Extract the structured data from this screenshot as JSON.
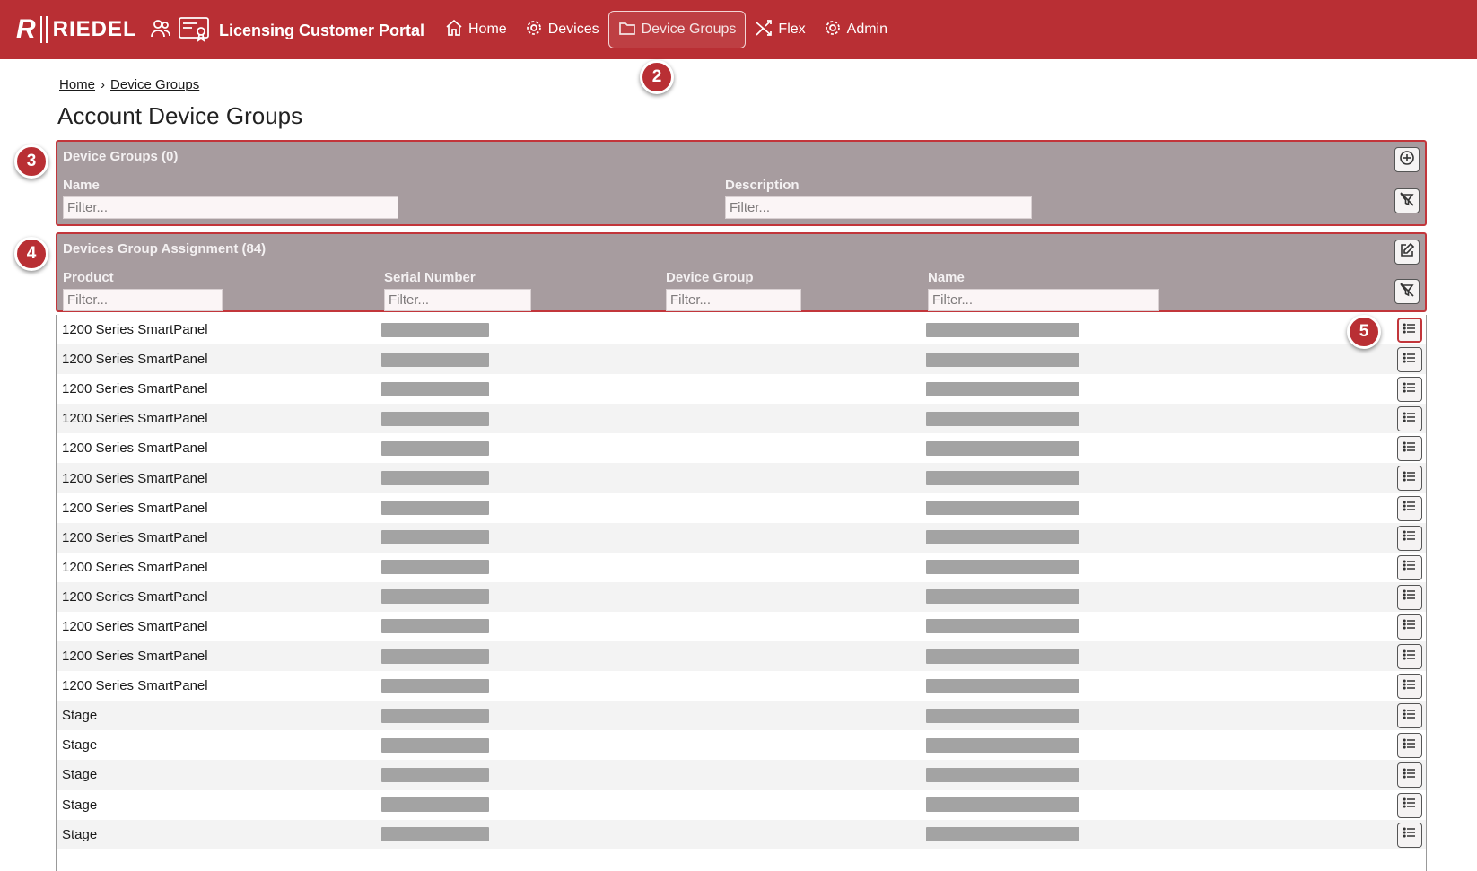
{
  "header": {
    "logo_text": "RIEDEL",
    "logo_mark": "R",
    "portal_title": "Licensing Customer Portal",
    "nav": [
      {
        "label": "Home",
        "icon": "home-icon",
        "active": false
      },
      {
        "label": "Devices",
        "icon": "gear-icon",
        "active": false
      },
      {
        "label": "Device Groups",
        "icon": "folder-icon",
        "active": true
      },
      {
        "label": "Flex",
        "icon": "shuffle-icon",
        "active": false
      },
      {
        "label": "Admin",
        "icon": "gear-icon",
        "active": false
      }
    ]
  },
  "breadcrumb": {
    "home": "Home",
    "separator": "›",
    "current": "Device Groups"
  },
  "page_title": "Account Device Groups",
  "device_groups_panel": {
    "title": "Device Groups (0)",
    "columns": [
      "Name",
      "Description"
    ],
    "filter_placeholder": "Filter..."
  },
  "assignment_panel": {
    "title": "Devices Group Assignment (84)",
    "columns": [
      "Product",
      "Serial Number",
      "Device Group",
      "Name"
    ],
    "filter_placeholder": "Filter..."
  },
  "rows": [
    {
      "product": "1200 Series SmartPanel"
    },
    {
      "product": "1200 Series SmartPanel"
    },
    {
      "product": "1200 Series SmartPanel"
    },
    {
      "product": "1200 Series SmartPanel"
    },
    {
      "product": "1200 Series SmartPanel"
    },
    {
      "product": "1200 Series SmartPanel"
    },
    {
      "product": "1200 Series SmartPanel"
    },
    {
      "product": "1200 Series SmartPanel"
    },
    {
      "product": "1200 Series SmartPanel"
    },
    {
      "product": "1200 Series SmartPanel"
    },
    {
      "product": "1200 Series SmartPanel"
    },
    {
      "product": "1200 Series SmartPanel"
    },
    {
      "product": "1200 Series SmartPanel"
    },
    {
      "product": "Stage"
    },
    {
      "product": "Stage"
    },
    {
      "product": "Stage"
    },
    {
      "product": "Stage"
    },
    {
      "product": "Stage"
    }
  ],
  "badges": [
    "2",
    "3",
    "4",
    "5"
  ],
  "colors": {
    "brand_red": "#b92f34",
    "panel_gray": "#a79c9f",
    "highlight_border": "#c2363b"
  }
}
